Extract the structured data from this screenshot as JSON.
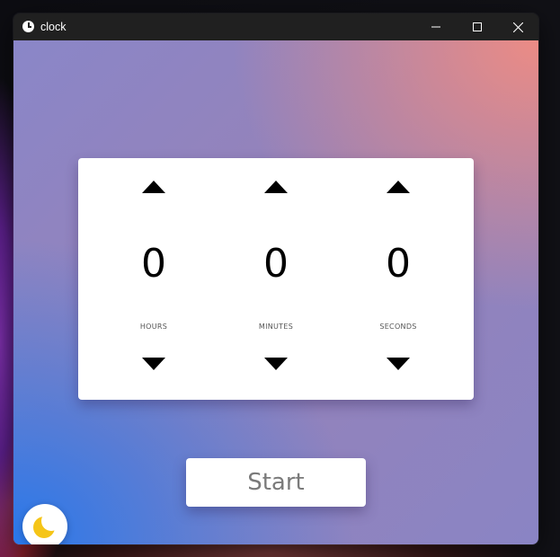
{
  "window": {
    "title": "clock",
    "app_icon": "clock-icon",
    "controls": {
      "minimize": "minimize-icon",
      "maximize": "maximize-icon",
      "close": "close-icon"
    }
  },
  "timer": {
    "columns": [
      {
        "value": "0",
        "unit": "HOURS",
        "up_icon": "triangle-up-icon",
        "down_icon": "triangle-down-icon"
      },
      {
        "value": "0",
        "unit": "MINUTES",
        "up_icon": "triangle-up-icon",
        "down_icon": "triangle-down-icon"
      },
      {
        "value": "0",
        "unit": "SECONDS",
        "up_icon": "triangle-up-icon",
        "down_icon": "triangle-down-icon"
      }
    ]
  },
  "start_button": {
    "label": "Start"
  },
  "theme_toggle": {
    "icon": "moon-icon"
  },
  "colors": {
    "titlebar": "#202020",
    "gradient_top_right": "#f08c82",
    "gradient_bottom_left": "#2878eb",
    "gradient_mid": "#8a86c8",
    "card": "#ffffff",
    "moon": "#f5c518"
  }
}
